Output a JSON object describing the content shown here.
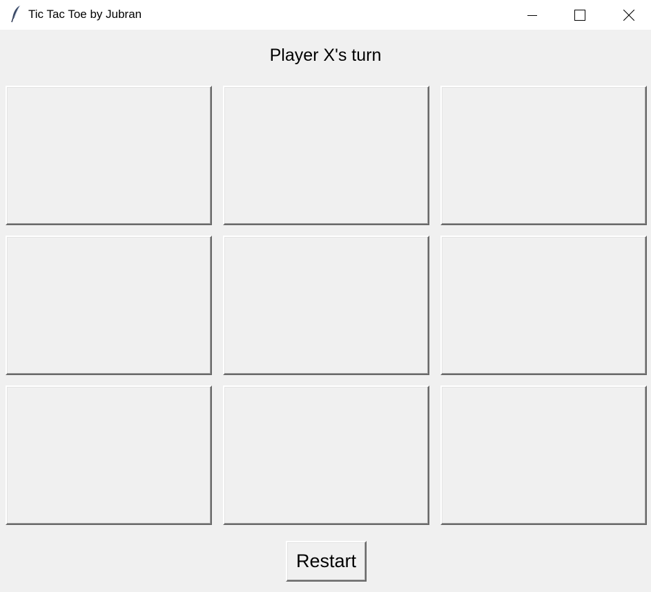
{
  "window": {
    "title": "Tic Tac Toe by Jubran",
    "icon": "feather-icon",
    "controls": [
      "minimize-icon",
      "maximize-icon",
      "close-icon"
    ]
  },
  "game": {
    "status": "Player X's turn",
    "board": [
      [
        "",
        "",
        ""
      ],
      [
        "",
        "",
        ""
      ],
      [
        "",
        "",
        ""
      ]
    ],
    "restart_label": "Restart"
  },
  "colors": {
    "background": "#f0f0f0",
    "titlebar": "#ffffff",
    "text": "#000000"
  }
}
